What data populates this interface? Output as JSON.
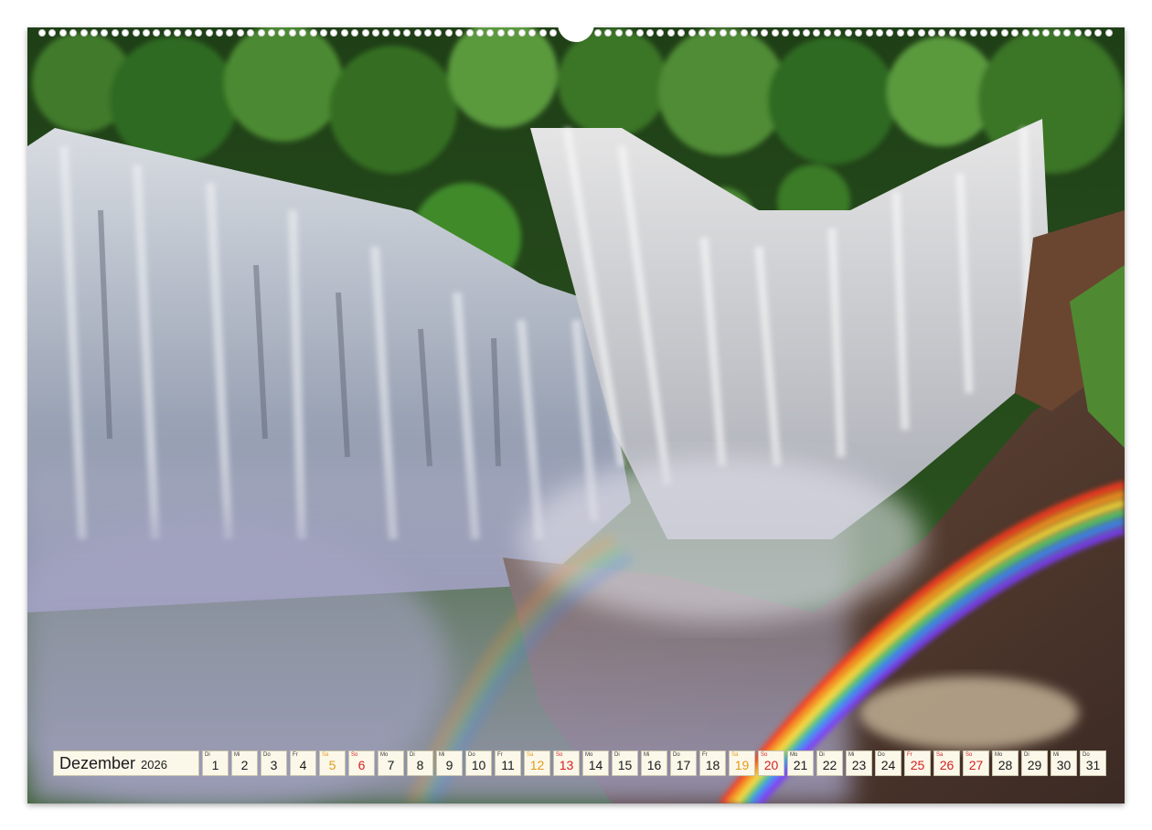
{
  "calendar": {
    "month": "Dezember",
    "year": "2026",
    "days": [
      {
        "wd": "Di",
        "n": "1",
        "type": "wk"
      },
      {
        "wd": "Mi",
        "n": "2",
        "type": "wk"
      },
      {
        "wd": "Do",
        "n": "3",
        "type": "wk"
      },
      {
        "wd": "Fr",
        "n": "4",
        "type": "wk"
      },
      {
        "wd": "Sa",
        "n": "5",
        "type": "sat"
      },
      {
        "wd": "So",
        "n": "6",
        "type": "sun"
      },
      {
        "wd": "Mo",
        "n": "7",
        "type": "wk"
      },
      {
        "wd": "Di",
        "n": "8",
        "type": "wk"
      },
      {
        "wd": "Mi",
        "n": "9",
        "type": "wk"
      },
      {
        "wd": "Do",
        "n": "10",
        "type": "wk"
      },
      {
        "wd": "Fr",
        "n": "11",
        "type": "wk"
      },
      {
        "wd": "Sa",
        "n": "12",
        "type": "sat"
      },
      {
        "wd": "So",
        "n": "13",
        "type": "sun"
      },
      {
        "wd": "Mo",
        "n": "14",
        "type": "wk"
      },
      {
        "wd": "Di",
        "n": "15",
        "type": "wk"
      },
      {
        "wd": "Mi",
        "n": "16",
        "type": "wk"
      },
      {
        "wd": "Do",
        "n": "17",
        "type": "wk"
      },
      {
        "wd": "Fr",
        "n": "18",
        "type": "wk"
      },
      {
        "wd": "Sa",
        "n": "19",
        "type": "sat"
      },
      {
        "wd": "So",
        "n": "20",
        "type": "sun"
      },
      {
        "wd": "Mo",
        "n": "21",
        "type": "wk"
      },
      {
        "wd": "Di",
        "n": "22",
        "type": "wk"
      },
      {
        "wd": "Mi",
        "n": "23",
        "type": "wk"
      },
      {
        "wd": "Do",
        "n": "24",
        "type": "wk"
      },
      {
        "wd": "Fr",
        "n": "25",
        "type": "hol"
      },
      {
        "wd": "Sa",
        "n": "26",
        "type": "hol"
      },
      {
        "wd": "So",
        "n": "27",
        "type": "sun"
      },
      {
        "wd": "Mo",
        "n": "28",
        "type": "wk"
      },
      {
        "wd": "Di",
        "n": "29",
        "type": "wk"
      },
      {
        "wd": "Mi",
        "n": "30",
        "type": "wk"
      },
      {
        "wd": "Do",
        "n": "31",
        "type": "wk"
      }
    ]
  },
  "colors": {
    "saturday": "#e39a17",
    "sunday_holiday": "#d62020",
    "cell_bg": "#fbf8ea"
  }
}
